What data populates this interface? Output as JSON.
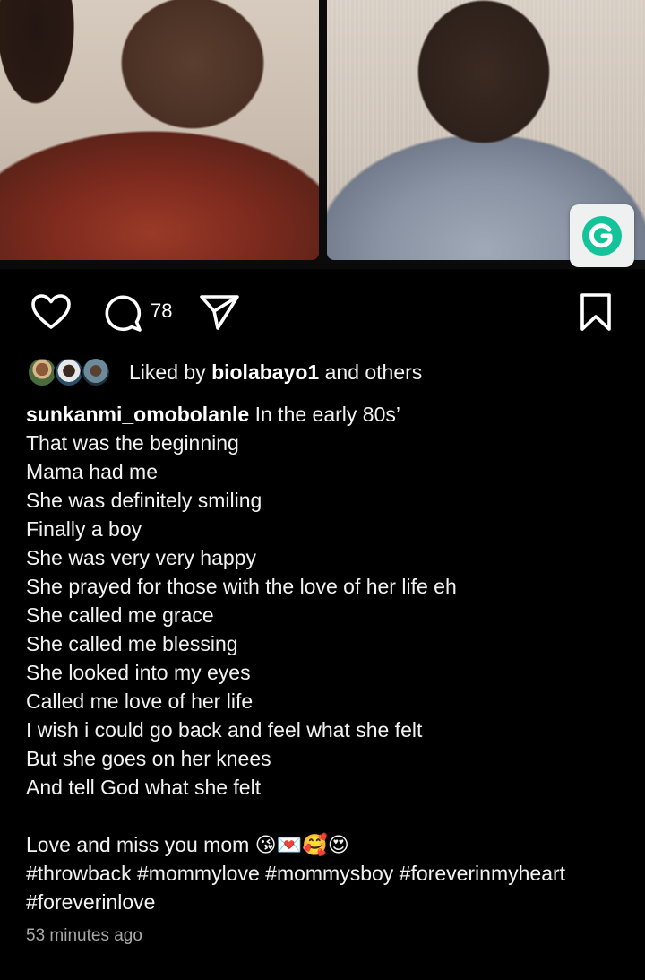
{
  "post": {
    "photos": [
      "photo-mother",
      "photo-son"
    ],
    "badge_icon": "grammarly-g-icon",
    "badge_color": "#15c39a",
    "actions": {
      "like_icon": "heart-icon",
      "comment_icon": "comment-icon",
      "comment_count": "78",
      "share_icon": "send-icon",
      "save_icon": "bookmark-icon"
    },
    "liked_by": {
      "prefix": "Liked by",
      "user": "biolabayo1",
      "suffix": "and others"
    },
    "caption": {
      "username": "sunkanmi_omobolanle",
      "first_line": "In the early 80s’",
      "lines": [
        "That was the beginning",
        "Mama had me",
        "She was definitely smiling",
        "Finally a boy",
        "She was very very happy",
        "She prayed for those with the love of her life eh",
        "She called me grace",
        "She called me blessing",
        "She looked into my eyes",
        "Called me love of her life",
        "I wish i could go back and feel what she felt",
        "But she goes on her knees",
        "And tell God what she felt"
      ],
      "closing": "Love and miss you mom 😘💌🥰😍",
      "hashtags": "#throwback #mommylove #mommysboy #foreverinmyheart #foreverinlove"
    },
    "timestamp": "53 minutes ago"
  }
}
